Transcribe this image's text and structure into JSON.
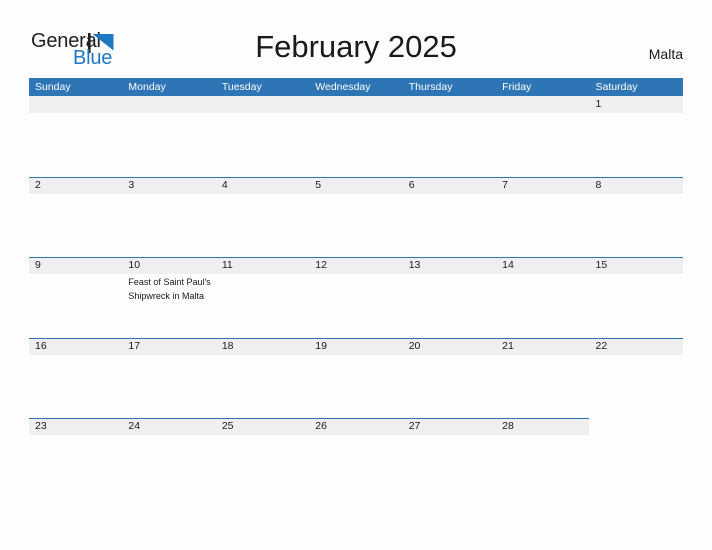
{
  "logo": {
    "word_one": "General",
    "word_two": "Blue",
    "mark": "blue-flag-triangle",
    "dark_color": "#231f20",
    "blue_color": "#1f78c1"
  },
  "header": {
    "title": "February 2025",
    "country": "Malta"
  },
  "theme": {
    "header_blue": "#2e75b6",
    "row_band_gray": "#efefef",
    "page_background": "#fdfdfd",
    "text_color": "#1a1a1a"
  },
  "calendar": {
    "month": "February",
    "year": "2025",
    "weekday_headers": [
      "Sunday",
      "Monday",
      "Tuesday",
      "Wednesday",
      "Thursday",
      "Friday",
      "Saturday"
    ],
    "weeks": [
      {
        "days": [
          {
            "num": ""
          },
          {
            "num": ""
          },
          {
            "num": ""
          },
          {
            "num": ""
          },
          {
            "num": ""
          },
          {
            "num": ""
          },
          {
            "num": "1"
          }
        ]
      },
      {
        "days": [
          {
            "num": "2"
          },
          {
            "num": "3"
          },
          {
            "num": "4"
          },
          {
            "num": "5"
          },
          {
            "num": "6"
          },
          {
            "num": "7"
          },
          {
            "num": "8"
          }
        ]
      },
      {
        "days": [
          {
            "num": "9"
          },
          {
            "num": "10",
            "event": "Feast of Saint Paul's Shipwreck in Malta"
          },
          {
            "num": "11"
          },
          {
            "num": "12"
          },
          {
            "num": "13"
          },
          {
            "num": "14"
          },
          {
            "num": "15"
          }
        ]
      },
      {
        "days": [
          {
            "num": "16"
          },
          {
            "num": "17"
          },
          {
            "num": "18"
          },
          {
            "num": "19"
          },
          {
            "num": "20"
          },
          {
            "num": "21"
          },
          {
            "num": "22"
          }
        ]
      },
      {
        "days": [
          {
            "num": "23"
          },
          {
            "num": "24"
          },
          {
            "num": "25"
          },
          {
            "num": "26"
          },
          {
            "num": "27"
          },
          {
            "num": "28"
          },
          {
            "num": ""
          }
        ]
      }
    ]
  }
}
